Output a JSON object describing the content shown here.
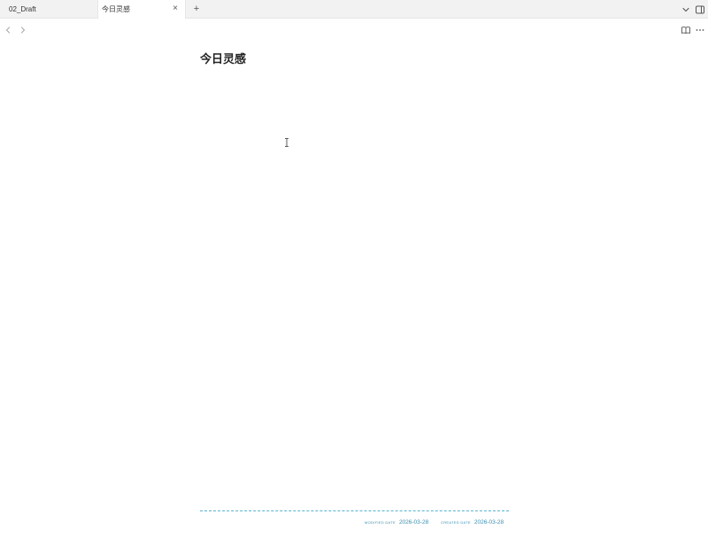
{
  "tabs": [
    {
      "label": "02_Draft",
      "active": false
    },
    {
      "label": "今日灵感",
      "active": true
    }
  ],
  "tab_controls": {
    "close_glyph": "×",
    "new_tab_glyph": "+"
  },
  "note": {
    "title": "今日灵感"
  },
  "footer": {
    "modified_label": "MODIFIED DATE",
    "modified_value": "2026-03-28",
    "created_label": "CREATED DATE",
    "created_value": "2026-03-28"
  },
  "icons": {
    "back": "chevron-left-icon",
    "forward": "chevron-right-icon",
    "tab_list": "chevron-down-icon",
    "sidebar": "sidebar-toggle-icon",
    "reading": "book-open-icon",
    "more": "more-horizontal-icon",
    "cursor": "text-cursor-icon"
  },
  "colors": {
    "accent": "#3b8fb0",
    "divider": "#58b3cf",
    "tabbar_bg": "#f2f2f2"
  }
}
